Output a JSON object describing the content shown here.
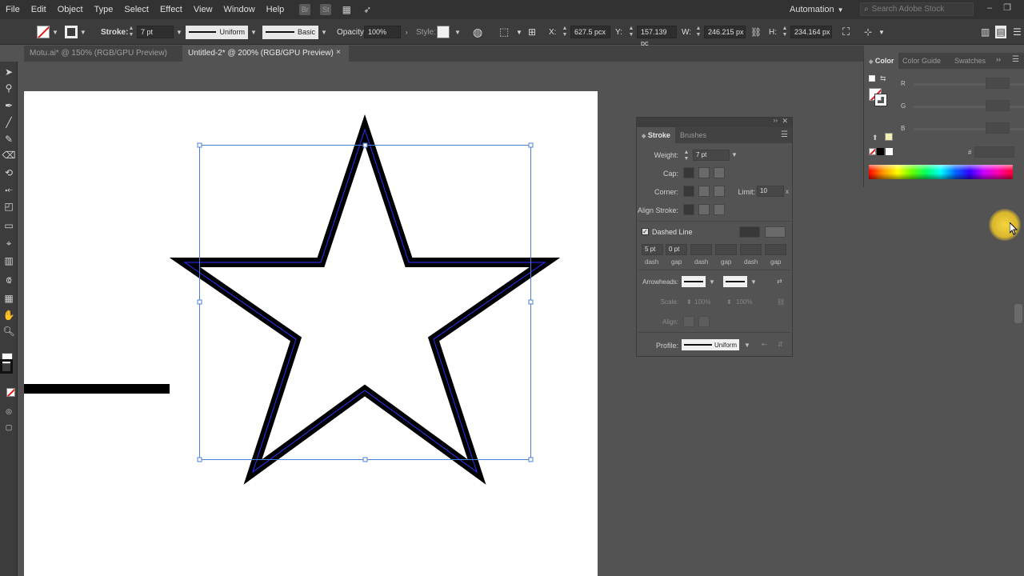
{
  "menubar": {
    "items": [
      "File",
      "Edit",
      "Object",
      "Type",
      "Select",
      "Effect",
      "View",
      "Window",
      "Help"
    ],
    "workspace": "Automation",
    "search_placeholder": "Search Adobe Stock"
  },
  "controlbar": {
    "stroke_label": "Stroke:",
    "stroke_weight": "7 pt",
    "profile": "Uniform",
    "brush": "Basic",
    "opacity_label": "Opacity:",
    "opacity": "100%",
    "style_label": "Style:",
    "x_label": "X:",
    "x": "627.5 pcx",
    "y_label": "Y:",
    "y": "157.139 pc",
    "w_label": "W:",
    "w": "246.215 px",
    "h_label": "H:",
    "h": "234.164 px"
  },
  "tabs": [
    {
      "label": "Motu.ai* @ 150% (RGB/GPU Preview)",
      "active": false
    },
    {
      "label": "Untitled-2* @ 200% (RGB/GPU Preview)",
      "active": true
    }
  ],
  "tab_close_glyph": "×",
  "stroke_panel": {
    "tabs": [
      "Stroke",
      "Brushes"
    ],
    "weight_label": "Weight:",
    "weight": "7 pt",
    "cap_label": "Cap:",
    "corner_label": "Corner:",
    "limit_label": "Limit:",
    "limit": "10",
    "limit_unit": "x",
    "align_label": "Align Stroke:",
    "dashed_label": "Dashed Line",
    "dashed_checked": true,
    "dash_values": [
      "5 pt",
      "0 pt",
      "",
      "",
      "",
      ""
    ],
    "dash_labels": [
      "dash",
      "gap",
      "dash",
      "gap",
      "dash",
      "gap"
    ],
    "arrowheads_label": "Arrowheads:",
    "scale_label": "Scale:",
    "scale_values": [
      "100%",
      "100%"
    ],
    "align_arrow_label": "Align:",
    "profile_label": "Profile:",
    "profile": "Uniform"
  },
  "color_panel": {
    "tabs": [
      "Color",
      "Color Guide",
      "Swatches"
    ],
    "channels": [
      "R",
      "G",
      "B"
    ],
    "hex_label": "#"
  },
  "colors": {
    "accent_selection": "#4a7fd6",
    "panel_bg": "#535353",
    "artboard": "#ffffff"
  },
  "icons": {
    "selection_tool": "selection-tool-icon",
    "direct_selection": "direct-selection-icon",
    "pen": "pen-tool-icon",
    "brush": "paintbrush-icon",
    "zoom": "zoom-icon",
    "cursor": "arrow-cursor-icon"
  }
}
